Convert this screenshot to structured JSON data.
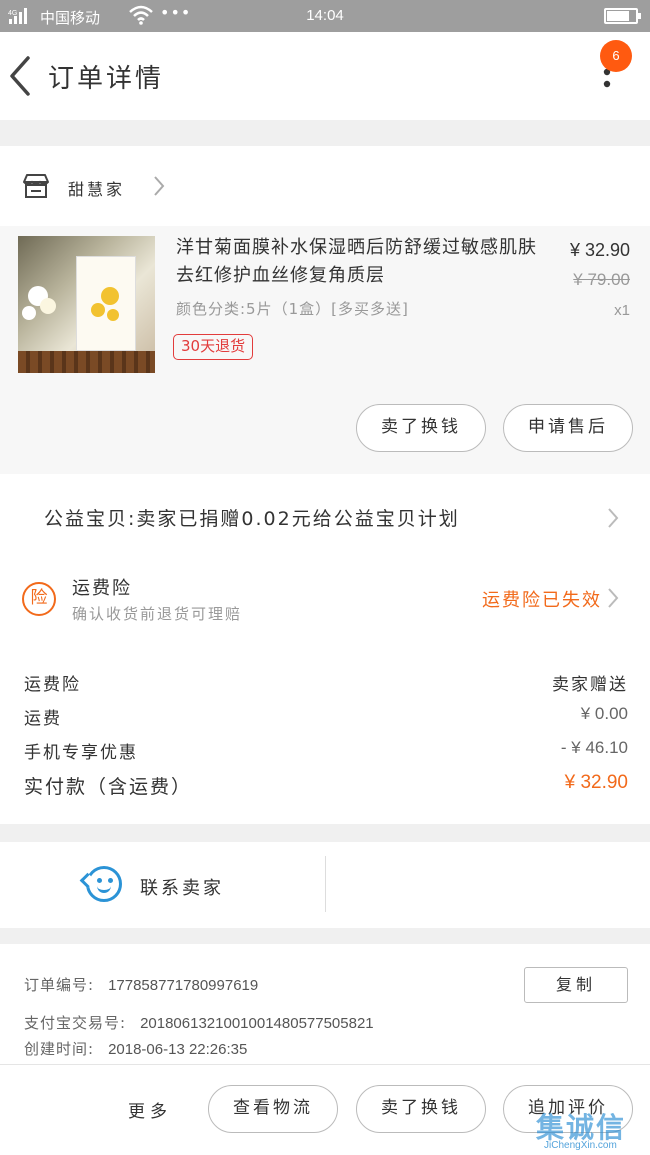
{
  "status_bar": {
    "signal": "4G",
    "carrier": "中国移动",
    "dots": "•••",
    "time": "14:04",
    "battery_level": 0.8
  },
  "header": {
    "title": "订单详情",
    "badge_count": "6"
  },
  "shop": {
    "name": "甜慧家"
  },
  "item": {
    "title": "洋甘菊面膜补水保湿晒后防舒缓过敏感肌肤去红修护血丝修复角质层",
    "sku": "颜色分类:5片（1盒）[多买多送]",
    "price": "¥ 32.90",
    "original_price": "¥ 79.00",
    "quantity": "x1",
    "tag": "30天退货",
    "actions": [
      "卖了换钱",
      "申请售后"
    ]
  },
  "charity": {
    "text": "公益宝贝:卖家已捐赠0.02元给公益宝贝计划"
  },
  "insurance": {
    "icon_text": "险",
    "title": "运费险",
    "subtitle": "确认收货前退货可理赔",
    "status": "运费险已失效",
    "status_color": "#f26a1b"
  },
  "fees": [
    {
      "label": "运费险",
      "value": "卖家赠送"
    },
    {
      "label": "运费",
      "value": "¥ 0.00"
    },
    {
      "label": "手机专享优惠",
      "value": "- ¥ 46.10"
    },
    {
      "label": "实付款（含运费）",
      "value": "¥ 32.90"
    }
  ],
  "contact": {
    "label": "联系卖家"
  },
  "order_info": {
    "order_no_label": "订单编号:",
    "order_no": "1778587717809976​19",
    "alipay_label": "支付宝交易号:",
    "alipay_no": "2018061321001001480577505821",
    "created_label": "创建时间:",
    "created": "2018-06-13  22:26:35",
    "copy_label": "复制"
  },
  "bottom_bar": {
    "more_label": "更多",
    "buttons": [
      "查看物流",
      "卖了换钱",
      "追加评价"
    ]
  },
  "watermark": {
    "logo": "集诚信",
    "sub": "JiChengXin.com"
  }
}
